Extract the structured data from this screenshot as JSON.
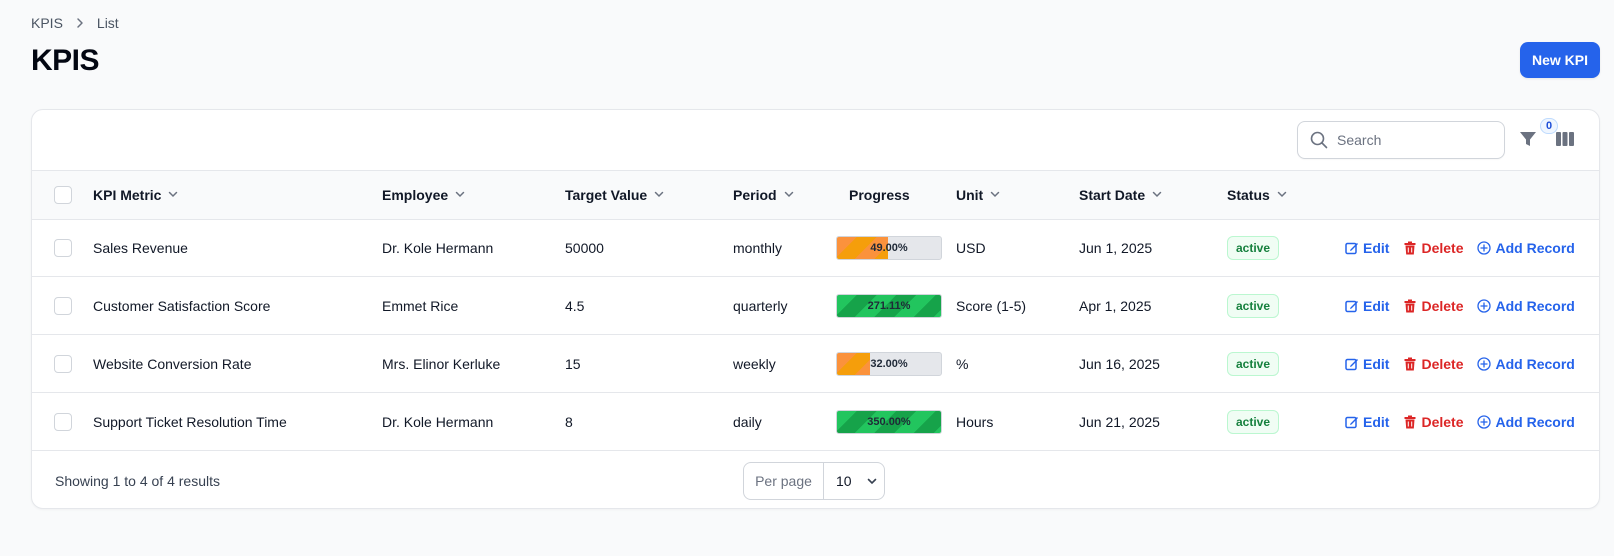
{
  "breadcrumb": {
    "root": "KPIS",
    "current": "List"
  },
  "page": {
    "title": "KPIS",
    "new_button": "New KPI"
  },
  "toolbar": {
    "search_placeholder": "Search",
    "filter_count": "0"
  },
  "columns": {
    "kpi_metric": "KPI Metric",
    "employee": "Employee",
    "target_value": "Target Value",
    "period": "Period",
    "progress": "Progress",
    "unit": "Unit",
    "start_date": "Start Date",
    "status": "Status"
  },
  "actions": {
    "edit": "Edit",
    "delete": "Delete",
    "add_record": "Add Record"
  },
  "rows": [
    {
      "metric": "Sales Revenue",
      "employee": "Dr. Kole Hermann",
      "target": "50000",
      "period": "monthly",
      "progress_label": "49.00%",
      "progress_pct": 49,
      "progress_color": "#f59e0b",
      "unit": "USD",
      "start_date": "Jun 1, 2025",
      "status": "active"
    },
    {
      "metric": "Customer Satisfaction Score",
      "employee": "Emmet Rice",
      "target": "4.5",
      "period": "quarterly",
      "progress_label": "271.11%",
      "progress_pct": 100,
      "progress_color": "#16a34a",
      "unit": "Score (1-5)",
      "start_date": "Apr 1, 2025",
      "status": "active"
    },
    {
      "metric": "Website Conversion Rate",
      "employee": "Mrs. Elinor Kerluke",
      "target": "15",
      "period": "weekly",
      "progress_label": "32.00%",
      "progress_pct": 32,
      "progress_color": "#f59e0b",
      "unit": "%",
      "start_date": "Jun 16, 2025",
      "status": "active"
    },
    {
      "metric": "Support Ticket Resolution Time",
      "employee": "Dr. Kole Hermann",
      "target": "8",
      "period": "daily",
      "progress_label": "350.00%",
      "progress_pct": 100,
      "progress_color": "#16a34a",
      "unit": "Hours",
      "start_date": "Jun 21, 2025",
      "status": "active"
    }
  ],
  "footer": {
    "showing": "Showing 1 to 4 of 4 results",
    "per_page_label": "Per page",
    "per_page_value": "10"
  },
  "colors": {
    "primary": "#2563eb",
    "danger": "#dc2626",
    "success": "#15803d"
  }
}
